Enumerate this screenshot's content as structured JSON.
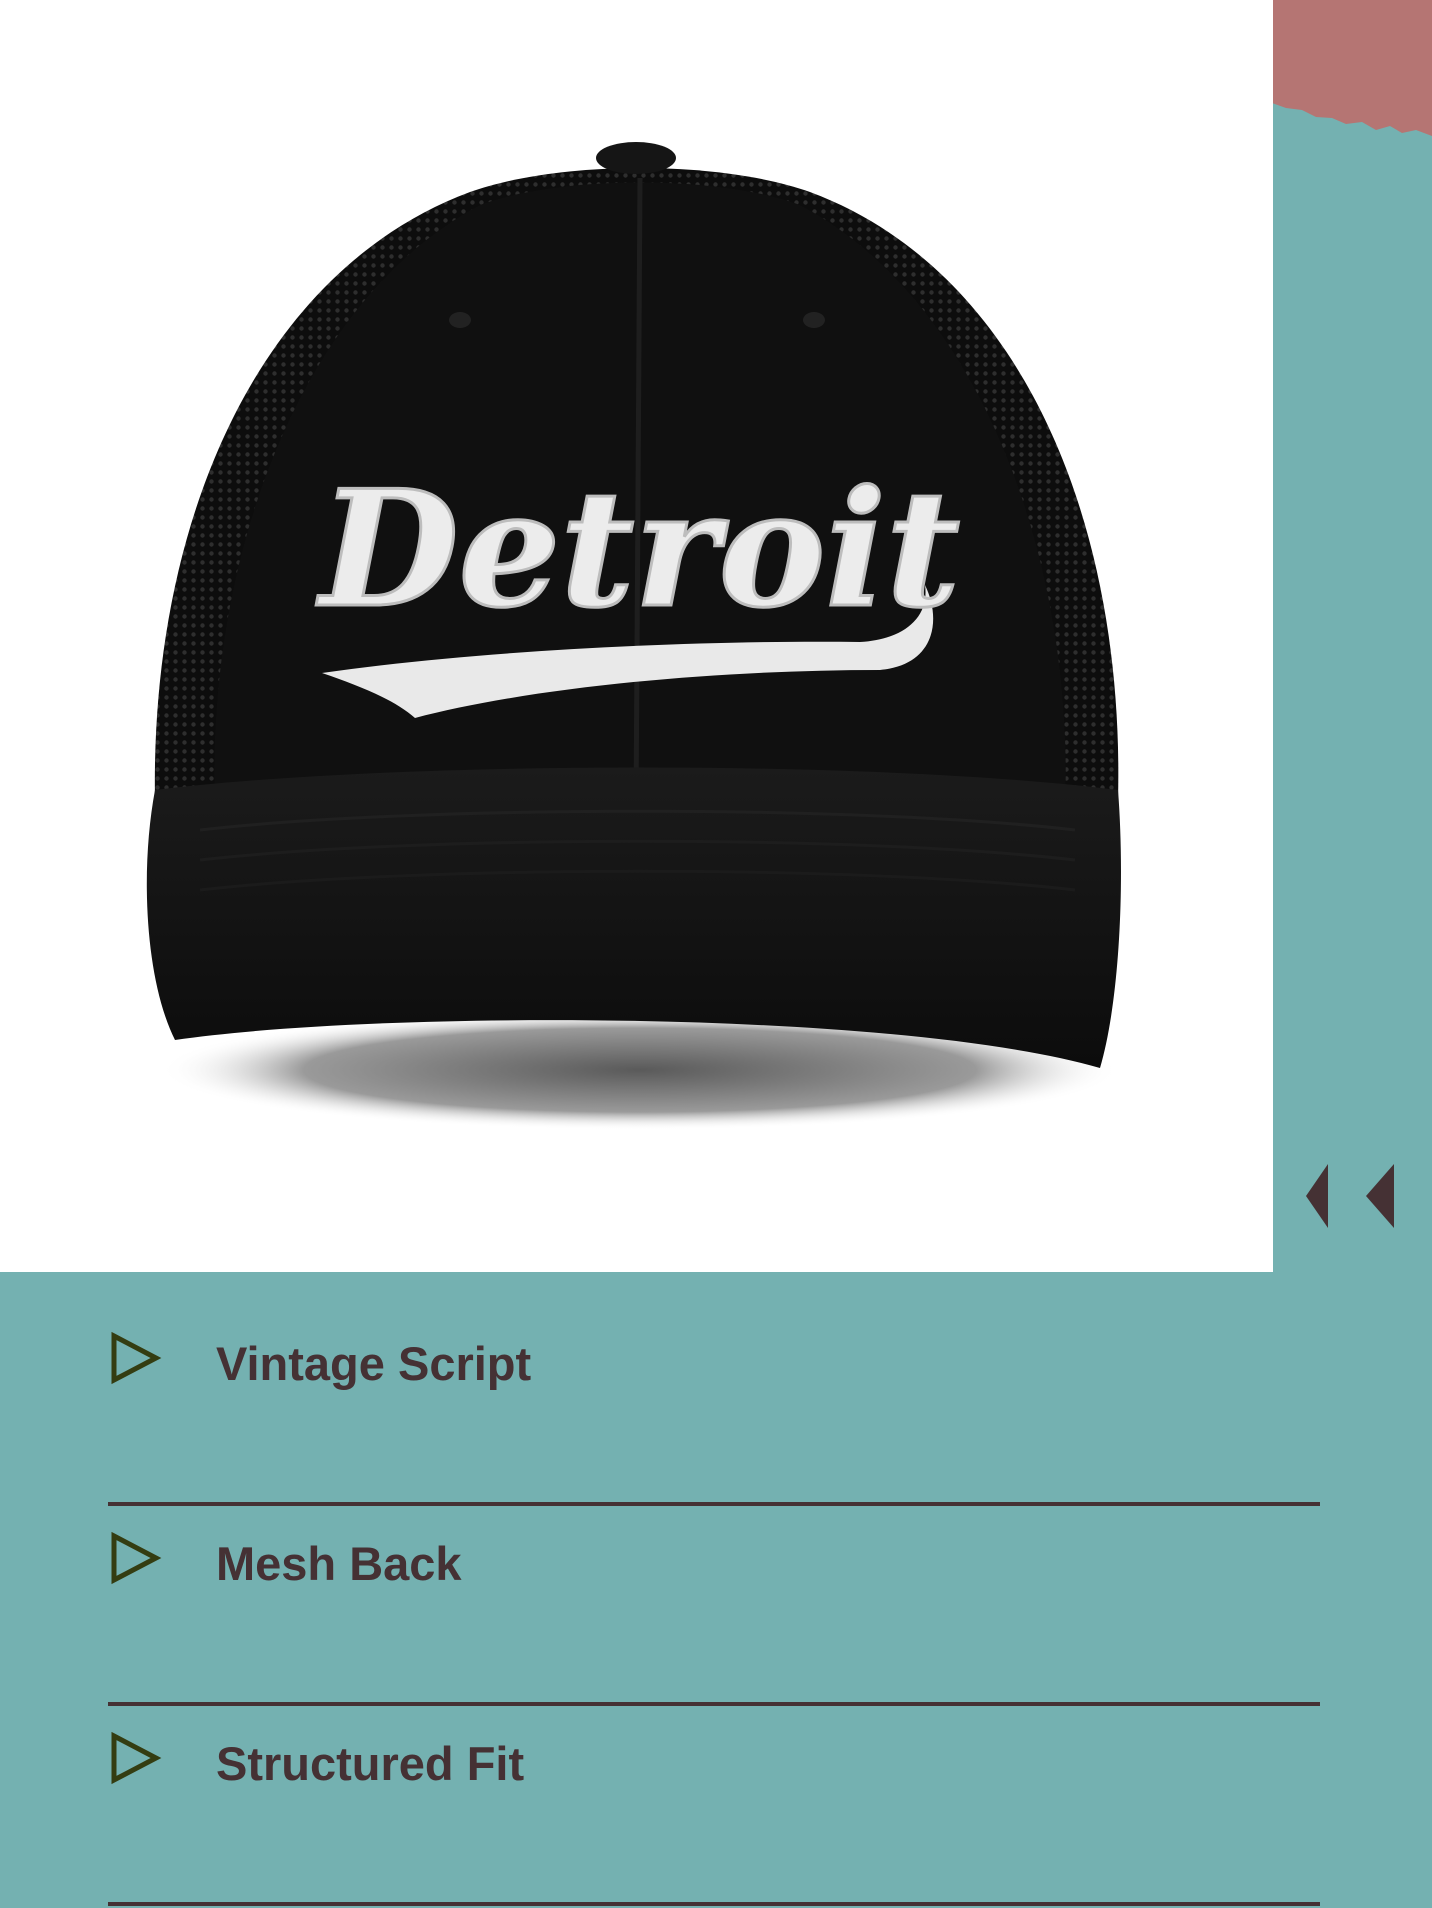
{
  "product_image": {
    "alt": "",
    "embroidered_text": "Detroit"
  },
  "features": [
    {
      "label": "Vintage Script",
      "icon": "play-outline-icon"
    },
    {
      "label": "Mesh Back",
      "icon": "play-outline-icon"
    },
    {
      "label": "Structured Fit",
      "icon": "play-outline-icon"
    }
  ],
  "colors": {
    "background": "#74b1b1",
    "accent": "#b57573",
    "text": "#453134",
    "icon": "#343d12",
    "image_bg": "#ffffff"
  }
}
